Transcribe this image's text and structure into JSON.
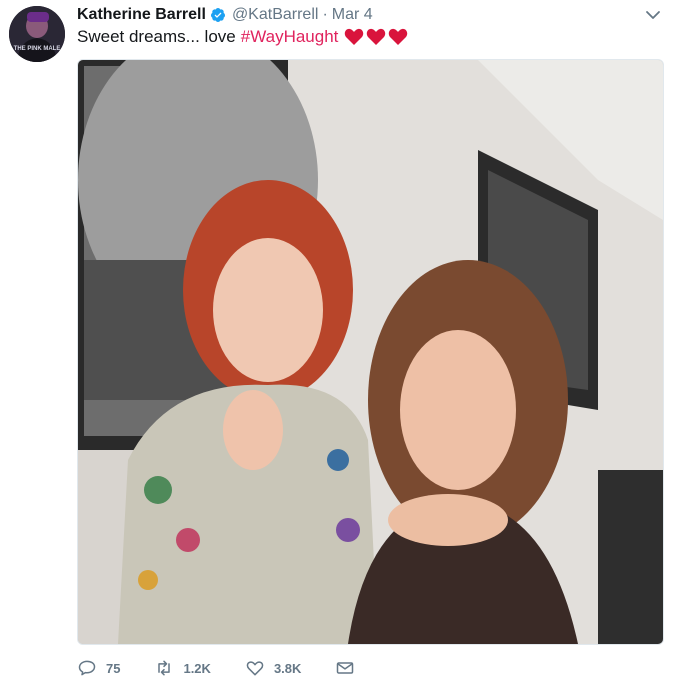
{
  "user": {
    "name": "Katherine Barrell",
    "handle": "@KatBarrell",
    "separator": "·",
    "date": "Mar 4",
    "avatar_text": "THE PINK MALE"
  },
  "tweet": {
    "text": "Sweet dreams... love",
    "hashtag": "#WayHaught",
    "emoji": [
      "heart-icon",
      "heart-icon",
      "heart-icon"
    ]
  },
  "actions": {
    "reply_count": "75",
    "retweet_count": "1.2K",
    "like_count": "3.8K"
  },
  "colors": {
    "hashtag": "#e0245e",
    "verified": "#1da1f2",
    "heart": "#e0245e",
    "secondary_text": "#657786"
  }
}
